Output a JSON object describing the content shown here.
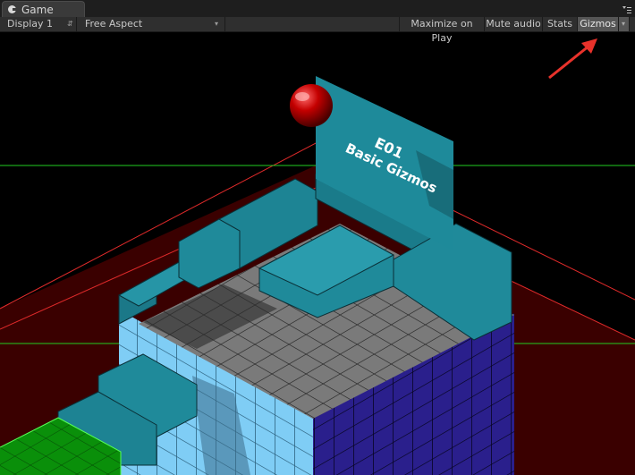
{
  "tab": {
    "title": "Game",
    "icon": "game-controller-icon"
  },
  "toolbar": {
    "display_select": "Display 1",
    "aspect_select": "Free Aspect",
    "maximize_on_play": "Maximize on Play",
    "mute_audio": "Mute audio",
    "stats": "Stats",
    "gizmos": "Gizmos"
  },
  "scene": {
    "sign_line1": "E01",
    "sign_line2": "Basic Gizmos"
  },
  "colors": {
    "toolbar_bg": "#2f2f2f",
    "gizmos_active_bg": "#555555",
    "teal_cube": "#1f8a9a",
    "light_blue": "#7fcdf5",
    "navy": "#2a1f8c",
    "gray_floor": "#7a7a7a",
    "green_lines": "#00ff00",
    "red_annotation": "#e8322b"
  }
}
